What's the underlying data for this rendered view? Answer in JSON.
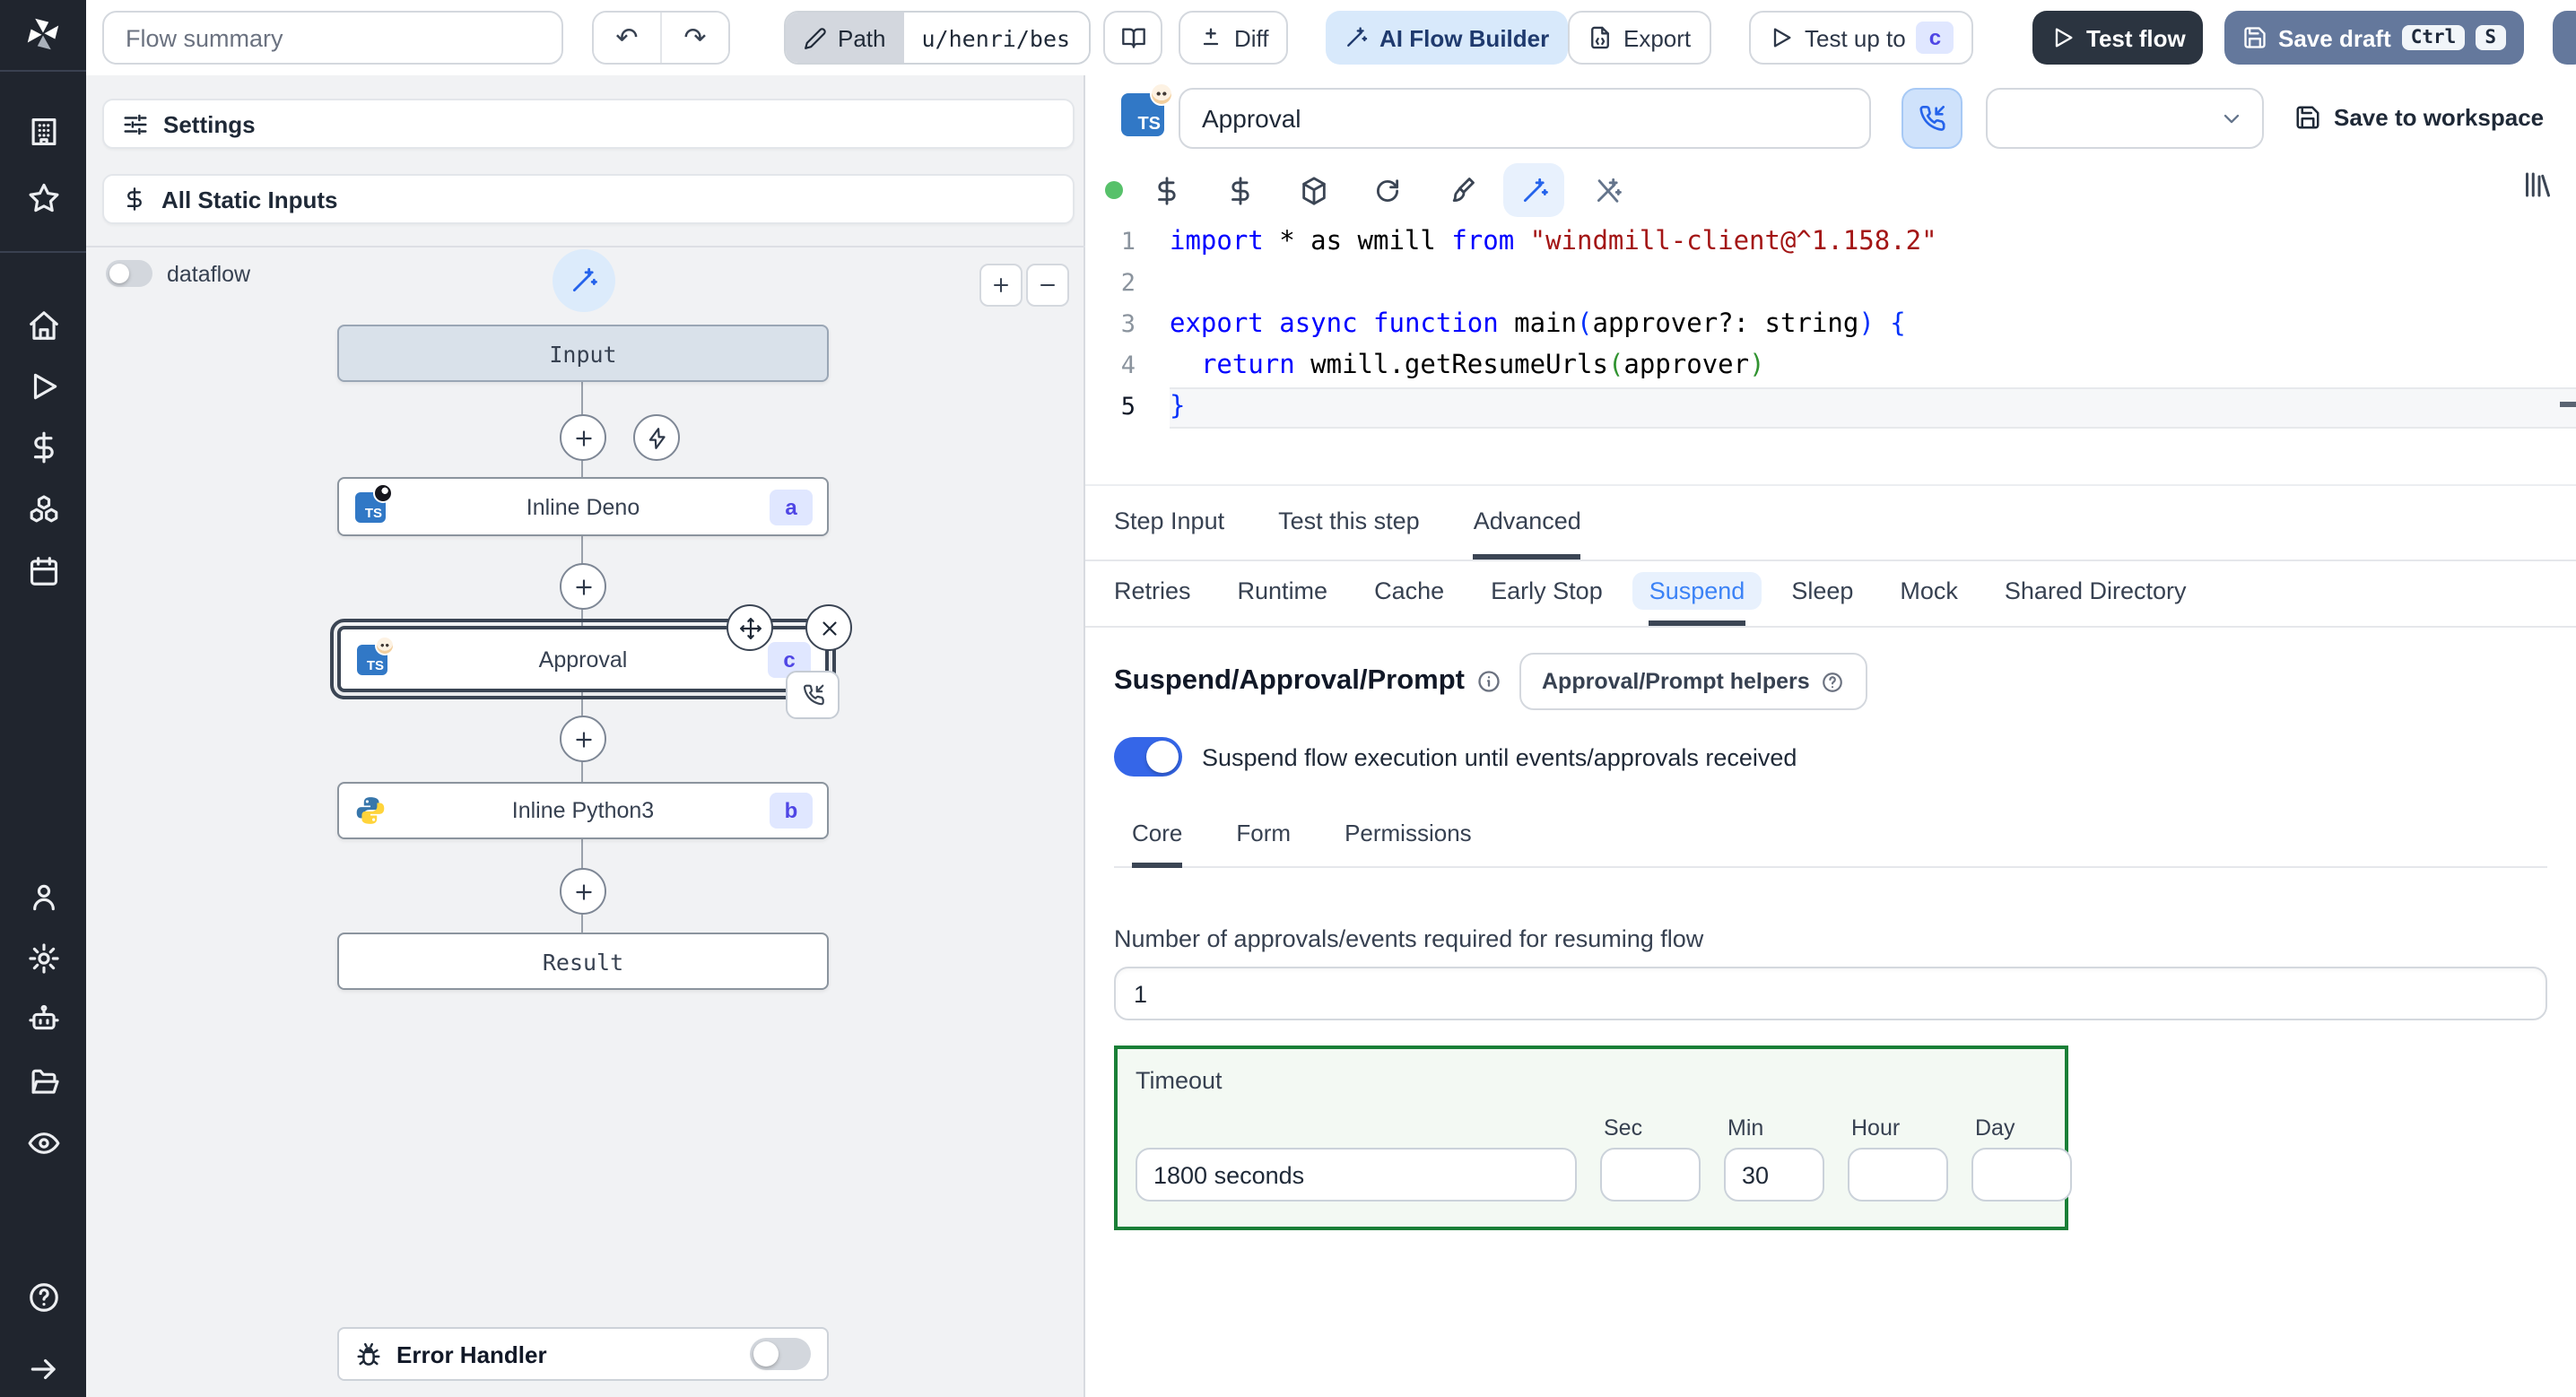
{
  "colors": {
    "sidebarBg": "#20252e",
    "panelBg": "#f1f2f4",
    "accent": "#3b82f6",
    "toggleOn": "#3566e8",
    "timeoutBorder": "#1a7f37",
    "timeoutBg": "#f3f9f3",
    "darkBtn": "#2b3440",
    "saveDraftBg": "#64789c",
    "aiBg": "#d8e9fb",
    "aiText": "#1f3a6e",
    "badgeBg": "#e0e7ff",
    "badgeText": "#4f46e5",
    "runDot": "#57c16a",
    "kw": "#0000ff",
    "str": "#a31515",
    "br1": "#0431fa",
    "br2": "#319331"
  },
  "topbar": {
    "flow_summary_placeholder": "Flow summary",
    "undo_icon": "↶",
    "redo_icon": "↷",
    "path_label": "Path",
    "path_value": "u/henri/bes",
    "diff_label": "Diff",
    "ai_label": "AI Flow Builder",
    "export_label": "Export",
    "test_up_to_label": "Test up to",
    "test_up_to_badge": "c",
    "test_flow_label": "Test flow",
    "save_draft_label": "Save draft",
    "save_draft_kbd": [
      "Ctrl",
      "S"
    ]
  },
  "sidebar": {
    "icons": [
      "windmill-logo",
      "workspace",
      "favorites",
      "home",
      "runs",
      "variables",
      "resources",
      "schedules",
      "users",
      "settings",
      "workers",
      "folders",
      "audit-logs",
      "help",
      "collapse"
    ]
  },
  "left": {
    "settings_label": "Settings",
    "static_inputs_label": "All Static Inputs",
    "dataflow_label": "dataflow",
    "dataflow_on": false,
    "error_handler_label": "Error Handler",
    "error_handler_on": false,
    "graph": {
      "input_label": "Input",
      "result_label": "Result",
      "steps": [
        {
          "label": "Inline Deno",
          "badge": "a",
          "lang": "deno",
          "selected": false
        },
        {
          "label": "Approval",
          "badge": "c",
          "lang": "deno",
          "selected": true
        },
        {
          "label": "Inline Python3",
          "badge": "b",
          "lang": "python3",
          "selected": false
        }
      ]
    }
  },
  "step": {
    "name_value": "Approval",
    "version_select_value": "",
    "save_to_workspace_label": "Save to workspace",
    "code": {
      "lines": [
        {
          "n": "1",
          "tokens": [
            {
              "c": "kw",
              "t": "import"
            },
            {
              "c": "pl",
              "t": " * as wmill "
            },
            {
              "c": "kw",
              "t": "from"
            },
            {
              "c": "pl",
              "t": " "
            },
            {
              "c": "str",
              "t": "\"windmill-client@^1.158.2\""
            }
          ]
        },
        {
          "n": "2",
          "tokens": []
        },
        {
          "n": "3",
          "tokens": [
            {
              "c": "kw",
              "t": "export"
            },
            {
              "c": "pl",
              "t": " "
            },
            {
              "c": "kw",
              "t": "async"
            },
            {
              "c": "pl",
              "t": " "
            },
            {
              "c": "kw",
              "t": "function"
            },
            {
              "c": "pl",
              "t": " main"
            },
            {
              "c": "br1",
              "t": "("
            },
            {
              "c": "pl",
              "t": "approver?: string"
            },
            {
              "c": "br1",
              "t": ")"
            },
            {
              "c": "pl",
              "t": " "
            },
            {
              "c": "br1",
              "t": "{"
            }
          ]
        },
        {
          "n": "4",
          "tokens": [
            {
              "c": "pl",
              "t": "  "
            },
            {
              "c": "kw",
              "t": "return"
            },
            {
              "c": "pl",
              "t": " wmill.getResumeUrls"
            },
            {
              "c": "br2",
              "t": "("
            },
            {
              "c": "pl",
              "t": "approver"
            },
            {
              "c": "br2",
              "t": ")"
            }
          ]
        },
        {
          "n": "5",
          "active": true,
          "tokens": [
            {
              "c": "br1",
              "t": "}"
            }
          ]
        }
      ]
    },
    "tabs_primary": [
      "Step Input",
      "Test this step",
      "Advanced"
    ],
    "tabs_primary_active": "Advanced",
    "tabs_advanced": [
      "Retries",
      "Runtime",
      "Cache",
      "Early Stop",
      "Suspend",
      "Sleep",
      "Mock",
      "Shared Directory"
    ],
    "tabs_advanced_active": "Suspend",
    "suspend": {
      "title": "Suspend/Approval/Prompt",
      "helpers_label": "Approval/Prompt helpers",
      "toggle_label": "Suspend flow execution until events/approvals received",
      "toggle_on": true,
      "tabs": [
        "Core",
        "Form",
        "Permissions"
      ],
      "tabs_active": "Core",
      "approvals_label": "Number of approvals/events required for resuming flow",
      "approvals_value": "1",
      "timeout": {
        "label": "Timeout",
        "display_value": "1800 seconds",
        "units": [
          "Sec",
          "Min",
          "Hour",
          "Day"
        ],
        "sec_value": "",
        "min_value": "30",
        "hour_value": "",
        "day_value": ""
      }
    }
  }
}
